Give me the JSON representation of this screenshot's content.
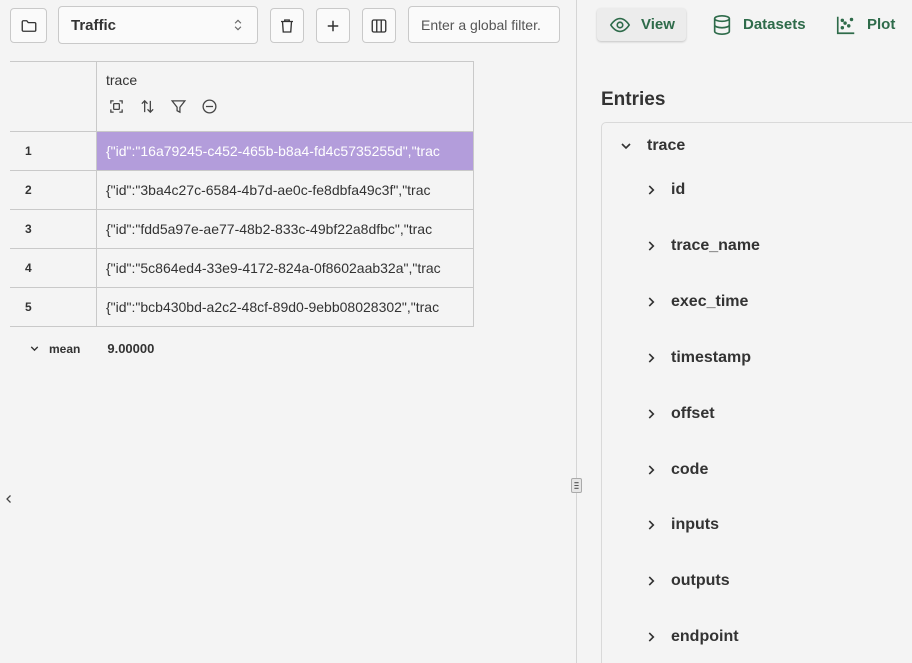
{
  "toolbar": {
    "folder_icon": "folder-icon",
    "dataset_select": {
      "value": "Traffic",
      "icon": "updown-icon"
    },
    "delete_icon": "trash-icon",
    "add_icon": "plus-icon",
    "columns_icon": "columns-icon",
    "filter_placeholder": "Enter a global filter."
  },
  "table": {
    "column": {
      "title": "trace",
      "icons": [
        "focus-icon",
        "sort-icon",
        "filter-icon",
        "remove-icon"
      ]
    },
    "rows": [
      {
        "index": "1",
        "value": "{\"id\":\"16a79245-c452-465b-b8a4-fd4c5735255d\",\"trac",
        "selected": true
      },
      {
        "index": "2",
        "value": "{\"id\":\"3ba4c27c-6584-4b7d-ae0c-fe8dbfa49c3f\",\"trac"
      },
      {
        "index": "3",
        "value": "{\"id\":\"fdd5a97e-ae77-48b2-833c-49bf22a8dfbc\",\"trac"
      },
      {
        "index": "4",
        "value": "{\"id\":\"5c864ed4-33e9-4172-824a-0f8602aab32a\",\"trac"
      },
      {
        "index": "5",
        "value": "{\"id\":\"bcb430bd-a2c2-48cf-89d0-9ebb08028302\",\"trac"
      }
    ],
    "summary": {
      "label": "mean",
      "value": "9.00000"
    },
    "selected_color": "#b39ddb"
  },
  "tabs": [
    {
      "label": "View",
      "icon": "eye-icon",
      "active": true
    },
    {
      "label": "Datasets",
      "icon": "database-icon"
    },
    {
      "label": "Plot",
      "icon": "scatter-icon"
    }
  ],
  "entries": {
    "title": "Entries",
    "root": "trace",
    "fields": [
      "id",
      "trace_name",
      "exec_time",
      "timestamp",
      "offset",
      "code",
      "inputs",
      "outputs",
      "endpoint"
    ]
  },
  "accent": "#2e6b4a"
}
